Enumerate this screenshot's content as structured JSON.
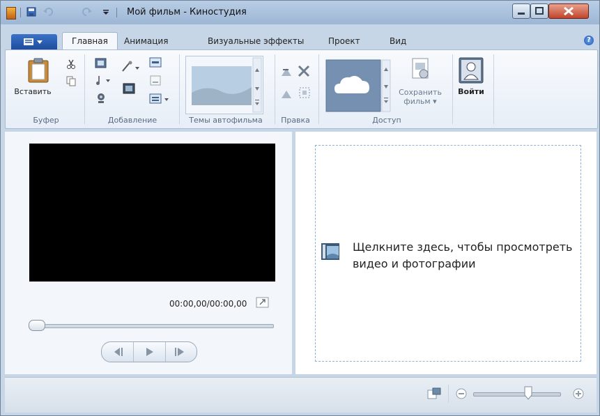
{
  "window": {
    "title": "Мой фильм - Киностудия"
  },
  "tabs": {
    "home": "Главная",
    "animation": "Анимация",
    "visual_effects": "Визуальные эффекты",
    "project": "Проект",
    "view": "Вид"
  },
  "ribbon": {
    "paste_label": "Вставить",
    "group_clipboard": "Буфер",
    "group_add": "Добавление",
    "group_autothemes": "Темы автофильма",
    "group_edit": "Правка",
    "group_share": "Доступ",
    "save_movie_line1": "Сохранить",
    "save_movie_line2": "фильм ▾",
    "signin_label": "Войти"
  },
  "preview": {
    "timecode": "00:00,00/00:00,00"
  },
  "storyboard": {
    "hint_line1": "Щелкните здесь, чтобы просмотреть",
    "hint_line2": "видео и фотографии"
  },
  "colors": {
    "accent": "#1d4d9e",
    "ribbon_bg": "#eef3f9",
    "video_bg": "#000000"
  }
}
